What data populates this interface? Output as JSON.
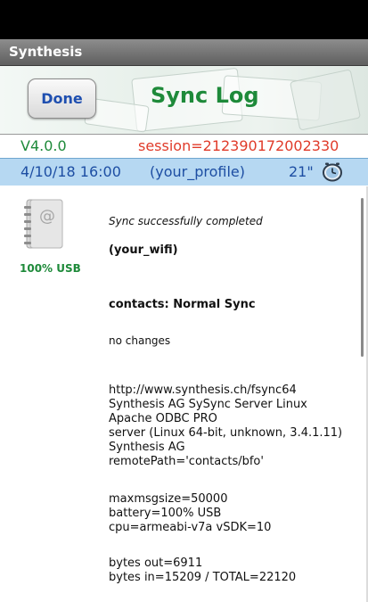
{
  "app": {
    "title": "Synthesis"
  },
  "header": {
    "done_label": "Done",
    "title": "Sync Log"
  },
  "info": {
    "version": "V4.0.0",
    "session": "session=212390172002330",
    "datetime": "4/10/18  16:00",
    "profile": "(your_profile)",
    "duration": "21\""
  },
  "sidebar": {
    "usb_status": "100% USB"
  },
  "log": {
    "status": "Sync successfully completed",
    "wifi": "(your_wifi)",
    "datastore": "contacts: Normal Sync",
    "changes": "no changes",
    "server_lines": [
      "http://www.synthesis.ch/fsync64",
      "Synthesis AG SySync Server Linux",
      "Apache ODBC PRO",
      "server (Linux 64-bit, unknown, 3.4.1.11)",
      "Synthesis AG",
      "remotePath='contacts/bfo'"
    ],
    "device_lines": [
      "maxmsgsize=50000",
      "battery=100% USB",
      "cpu=armeabi-v7a   vSDK=10"
    ],
    "bytes_lines": [
      "bytes out=6911",
      "bytes in=15209   / TOTAL=22120"
    ]
  },
  "colors": {
    "accent_green": "#1e8a3a",
    "session_red": "#e03b2a",
    "row_blue": "#b6d8f2",
    "link_blue": "#1d4ea3"
  },
  "icons": {
    "contacts": "address-book-icon",
    "clock": "clock-icon"
  }
}
